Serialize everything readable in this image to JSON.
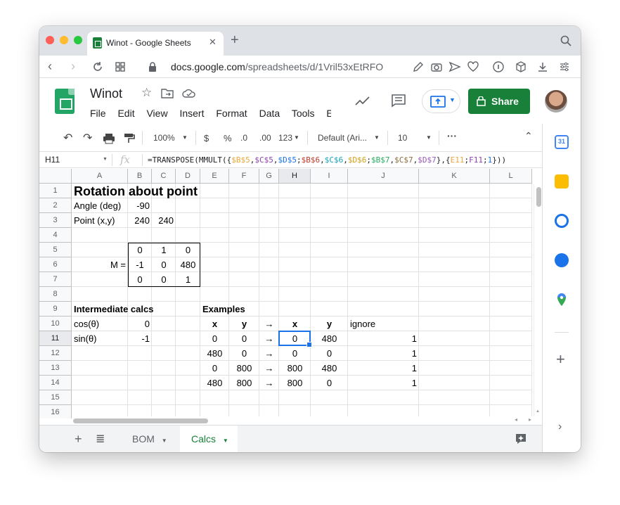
{
  "browser": {
    "tab_title": "Winot - Google Sheets",
    "url_host": "docs.google.com",
    "url_path": "/spreadsheets/d/1Vril53xEtRFO"
  },
  "doc": {
    "title": "Winot",
    "menus": [
      "File",
      "Edit",
      "View",
      "Insert",
      "Format",
      "Data",
      "Tools",
      "Ext"
    ],
    "share_label": "Share"
  },
  "toolbar": {
    "zoom": "100%",
    "currency": "$",
    "percent": "%",
    "dec_decrease": ".0",
    "dec_increase": ".00",
    "number_format": "123",
    "font": "Default (Ari...",
    "font_size": "10"
  },
  "formula_bar": {
    "name_box": "H11",
    "fx": "fx"
  },
  "grid": {
    "columns": [
      "A",
      "B",
      "C",
      "D",
      "E",
      "F",
      "G",
      "H",
      "I",
      "J",
      "K",
      "L"
    ],
    "rows": [
      "1",
      "2",
      "3",
      "4",
      "5",
      "6",
      "7",
      "8",
      "9",
      "10",
      "11",
      "12",
      "13",
      "14",
      "15",
      "16"
    ],
    "title": "Rotation about point",
    "angle_label": "Angle (deg)",
    "angle_value": "-90",
    "point_label": "Point (x,y)",
    "point_x": "240",
    "point_y": "240",
    "m_label": "M =",
    "matrix": [
      [
        "0",
        "1",
        "0"
      ],
      [
        "-1",
        "0",
        "480"
      ],
      [
        "0",
        "0",
        "1"
      ]
    ],
    "intermediate_label": "Intermediate calcs",
    "cos_label": "cos(θ)",
    "cos_value": "0",
    "sin_label": "sin(θ)",
    "sin_value": "-1",
    "examples_label": "Examples",
    "hdr_x": "x",
    "hdr_y": "y",
    "arrow": "→",
    "hdr_x2": "x",
    "hdr_y2": "y",
    "hdr_ignore": "ignore",
    "examples": [
      [
        "0",
        "0",
        "→",
        "0",
        "480",
        "1"
      ],
      [
        "480",
        "0",
        "→",
        "0",
        "0",
        "1"
      ],
      [
        "0",
        "800",
        "→",
        "800",
        "480",
        "1"
      ],
      [
        "480",
        "800",
        "→",
        "800",
        "0",
        "1"
      ]
    ]
  },
  "sheets": {
    "tabs": [
      "BOM",
      "Calcs"
    ],
    "active": "Calcs"
  },
  "colors": {
    "sheets_green": "#188038",
    "selection_blue": "#1a73e8"
  }
}
